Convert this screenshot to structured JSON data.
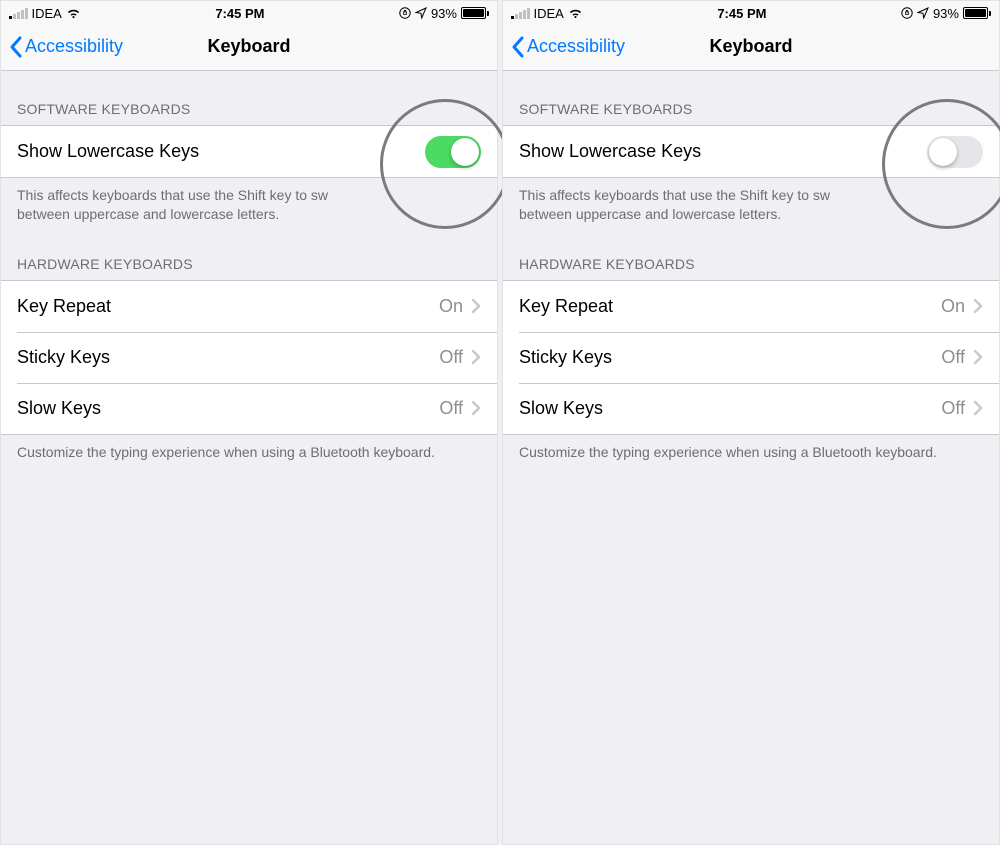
{
  "status": {
    "carrier": "IDEA",
    "time": "7:45 PM",
    "battery_pct": "93%",
    "signal_active_bars": 1
  },
  "nav": {
    "back_label": "Accessibility",
    "title": "Keyboard"
  },
  "software_section": {
    "header": "SOFTWARE KEYBOARDS",
    "row_label": "Show Lowercase Keys",
    "footer_part1": "This affects keyboards that use the Shift key to sw",
    "footer_part2": "between uppercase and lowercase letters."
  },
  "hardware_section": {
    "header": "HARDWARE KEYBOARDS",
    "rows": [
      {
        "label": "Key Repeat",
        "value": "On"
      },
      {
        "label": "Sticky Keys",
        "value": "Off"
      },
      {
        "label": "Slow Keys",
        "value": "Off"
      }
    ],
    "footer": "Customize the typing experience when using a Bluetooth keyboard."
  },
  "screens": [
    {
      "toggle_on": true
    },
    {
      "toggle_on": false
    }
  ],
  "colors": {
    "accent": "#007aff",
    "toggle_on": "#4cd964",
    "cell_value": "#8e8e93"
  }
}
